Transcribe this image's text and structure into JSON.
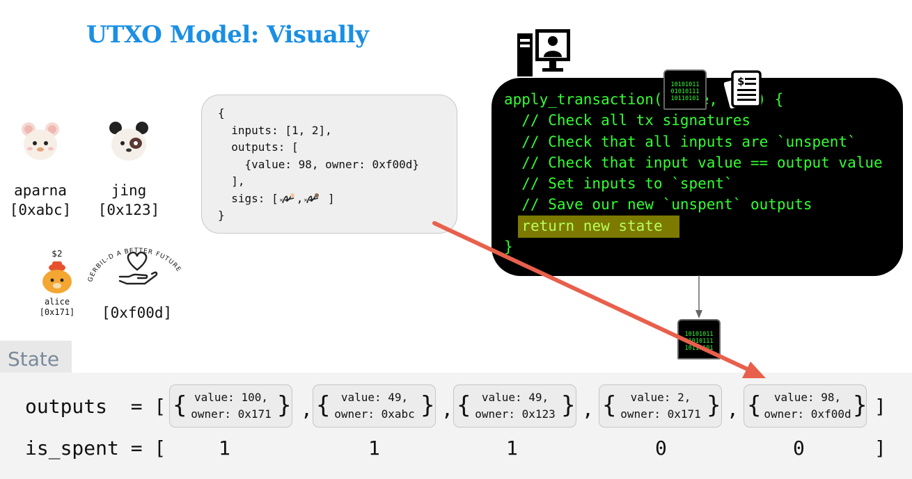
{
  "slide": {
    "title": "UTXO Model: Visually"
  },
  "users": [
    {
      "name": "aparna",
      "address": "[0xabc]",
      "icon": "hamster-icon"
    },
    {
      "name": "jing",
      "address": "[0x123]",
      "icon": "panda-hamster-icon"
    }
  ],
  "alice": {
    "balance": "$2",
    "name": "alice",
    "address": "[0x171]",
    "icon": "hamster-hat-icon"
  },
  "charity": {
    "logo_text": "GERBIL-D A BETTER FUTURE",
    "address": "[0xf00d]",
    "icon": "heart-hand-icon"
  },
  "transaction": {
    "lines": [
      "{",
      "  inputs: [1, 2],",
      "  outputs: [",
      "    {value: 98, owner: 0xf00d}",
      "  ],",
      "  sigs: "
    ],
    "sigs_mid": ",",
    "sigs_end": "]",
    "closing": "}"
  },
  "code": {
    "signature_start": "apply_transaction(",
    "signature_mid": "e,",
    "signature_end": " ) {",
    "comments": [
      "  // Check all tx signatures",
      "  // Check that all inputs are `unspent`",
      "  // Check that input value == output value",
      "  // Set inputs to `spent`",
      "  // Save our new `unspent` outputs"
    ],
    "return_line": "return new state",
    "closing": "}",
    "chip_bits": [
      "10101011",
      "01010111",
      "10110101"
    ],
    "icons": [
      "computer-user-icon",
      "binary-chip-icon",
      "receipt-icon"
    ]
  },
  "state": {
    "label": "State",
    "outputs_label": "outputs  = [",
    "is_spent_label": "is_spent = [",
    "outputs": [
      {
        "value": "value: 100,",
        "owner": "owner: 0x171"
      },
      {
        "value": "value: 49,",
        "owner": "owner: 0xabc"
      },
      {
        "value": "value: 49,",
        "owner": "owner: 0x123"
      },
      {
        "value": "value: 2,",
        "owner": "owner: 0x171"
      },
      {
        "value": "value: 98,",
        "owner": "owner: 0xf00d"
      }
    ],
    "separator": ",",
    "closing": "]",
    "is_spent": [
      "1",
      "1",
      "1",
      "0",
      "0"
    ]
  },
  "colors": {
    "title": "#1a8fe3",
    "code": "#32ff32",
    "arrow": "#e8604c",
    "highlight": "#7c7a00"
  }
}
